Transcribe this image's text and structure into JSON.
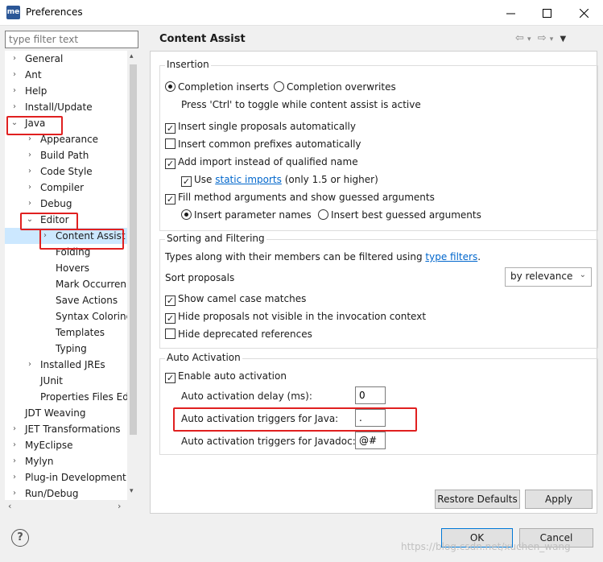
{
  "window": {
    "title": "Preferences",
    "app_icon": "me"
  },
  "filter": {
    "placeholder": "type filter text"
  },
  "tree": {
    "items": [
      {
        "label": "General",
        "chev": "›"
      },
      {
        "label": "Ant",
        "chev": "›"
      },
      {
        "label": "Help",
        "chev": "›"
      },
      {
        "label": "Install/Update",
        "chev": "›"
      },
      {
        "label": "Java",
        "chev": "⌄"
      },
      {
        "label": "Appearance",
        "chev": "›"
      },
      {
        "label": "Build Path",
        "chev": "›"
      },
      {
        "label": "Code Style",
        "chev": "›"
      },
      {
        "label": "Compiler",
        "chev": "›"
      },
      {
        "label": "Debug",
        "chev": "›"
      },
      {
        "label": "Editor",
        "chev": "⌄"
      },
      {
        "label": "Content Assist",
        "chev": "›"
      },
      {
        "label": "Folding",
        "chev": ""
      },
      {
        "label": "Hovers",
        "chev": ""
      },
      {
        "label": "Mark Occurren",
        "chev": ""
      },
      {
        "label": "Save Actions",
        "chev": ""
      },
      {
        "label": "Syntax Coloring",
        "chev": ""
      },
      {
        "label": "Templates",
        "chev": ""
      },
      {
        "label": "Typing",
        "chev": ""
      },
      {
        "label": "Installed JREs",
        "chev": "›"
      },
      {
        "label": "JUnit",
        "chev": ""
      },
      {
        "label": "Properties Files Ed",
        "chev": ""
      },
      {
        "label": "JDT Weaving",
        "chev": ""
      },
      {
        "label": "JET Transformations",
        "chev": "›"
      },
      {
        "label": "MyEclipse",
        "chev": "›"
      },
      {
        "label": "Mylyn",
        "chev": "›"
      },
      {
        "label": "Plug-in Development",
        "chev": "›"
      },
      {
        "label": "Run/Debug",
        "chev": "›"
      }
    ]
  },
  "page": {
    "title": "Content Assist"
  },
  "insertion": {
    "label": "Insertion",
    "completion_inserts": "Completion inserts",
    "completion_overwrites": "Completion overwrites",
    "toggle_hint": "Press 'Ctrl' to toggle while content assist is active",
    "insert_single": "Insert single proposals automatically",
    "insert_common": "Insert common prefixes automatically",
    "add_import": "Add import instead of qualified name",
    "use": "Use",
    "static_imports": "static imports",
    "only_15": "(only 1.5 or higher)",
    "fill_method": "Fill method arguments and show guessed arguments",
    "insert_param_names": "Insert parameter names",
    "insert_best_guessed": "Insert best guessed arguments"
  },
  "sorting": {
    "label": "Sorting and Filtering",
    "types_text": "Types along with their members can be filtered using",
    "type_filters": "type filters",
    "period": ".",
    "sort_label": "Sort proposals",
    "sort_value": "by relevance",
    "show_camel": "Show camel case matches",
    "hide_not_visible": "Hide proposals not visible in the invocation context",
    "hide_deprecated": "Hide deprecated references"
  },
  "auto": {
    "label": "Auto Activation",
    "enable": "Enable auto activation",
    "delay_label": "Auto activation delay (ms):",
    "delay_value": "0",
    "java_label": "Auto activation triggers for Java:",
    "java_value": ".",
    "javadoc_label": "Auto activation triggers for Javadoc:",
    "javadoc_value": "@#"
  },
  "buttons": {
    "restore": "Restore Defaults",
    "apply": "Apply",
    "ok": "OK",
    "cancel": "Cancel"
  },
  "help": {
    "glyph": "?"
  },
  "watermark": "https://blog.csdn.net/xuchen_wang"
}
